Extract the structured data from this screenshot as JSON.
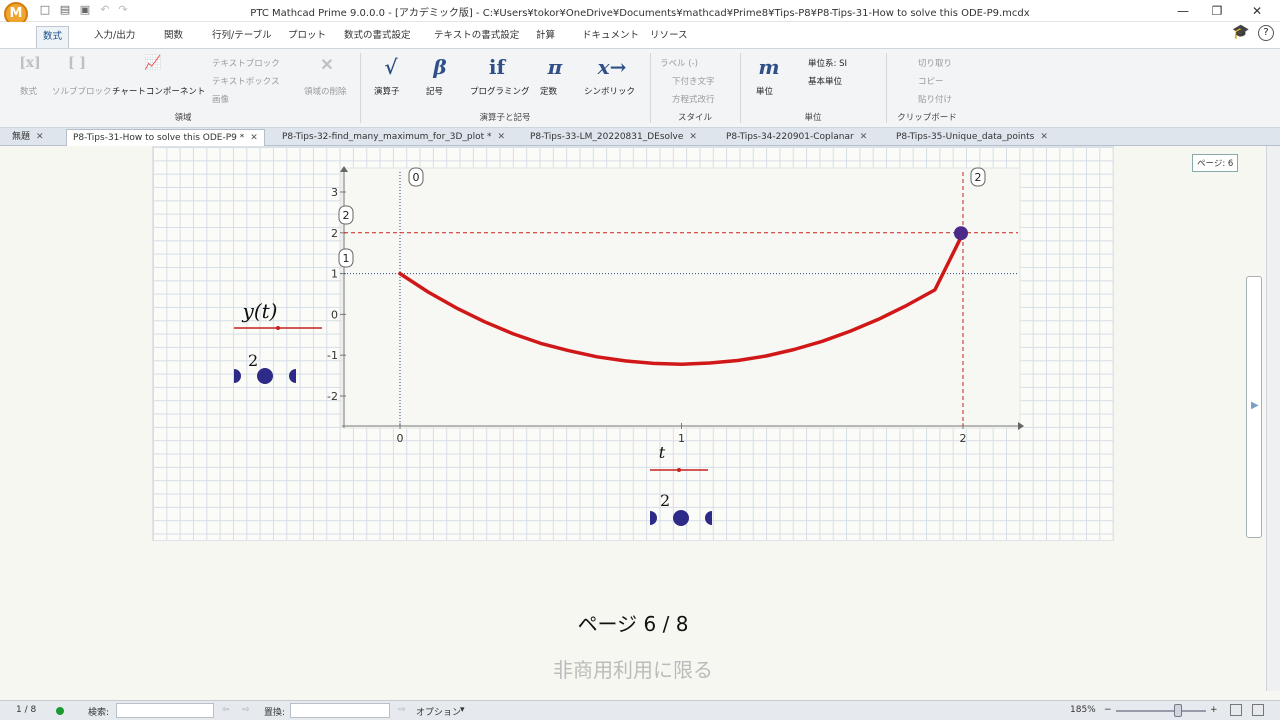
{
  "window": {
    "title": "PTC Mathcad Prime 9.0.0.0 - [アカデミック版] - C:¥Users¥tokor¥OneDrive¥Documents¥mathcad¥Prime8¥Tips-P8¥P8-Tips-31-How to solve this ODE-P9.mcdx",
    "logo_letter": "M"
  },
  "menu": {
    "tabs": [
      "数式",
      "入力/出力",
      "関数",
      "行列/テーブル",
      "プロット",
      "数式の書式設定",
      "テキストの書式設定",
      "計算",
      "ドキュメント",
      "リソース"
    ]
  },
  "ribbon": {
    "region": {
      "math": "数式",
      "solve_block": "ソルブブロック",
      "chart_component": "チャートコンポーネント",
      "text_block": "テキストブロック",
      "text_box": "テキストボックス",
      "image": "画像",
      "delete_region": "領域の削除",
      "label": "領域"
    },
    "operators": {
      "operators": "演算子",
      "symbols": "記号",
      "programming": "プログラミング",
      "constants": "定数",
      "symbolic": "シンボリック",
      "label": "演算子と記号"
    },
    "style": {
      "label_btn": "ラベル (-)",
      "subscript": "下付き文字",
      "equation_wrap": "方程式改行",
      "label": "スタイル"
    },
    "units": {
      "units": "単位",
      "unit_system": "単位系: SI",
      "base_units": "基本単位",
      "label": "単位"
    },
    "clipboard": {
      "cut": "切り取り",
      "copy": "コピー",
      "paste": "貼り付け",
      "label": "クリップボード"
    }
  },
  "doc_tabs": [
    {
      "label": "無題"
    },
    {
      "label": "P8-Tips-31-How to solve this ODE-P9 *"
    },
    {
      "label": "P8-Tips-32-find_many_maximum_for_3D_plot *"
    },
    {
      "label": "P8-Tips-33-LM_20220831_DEsolve"
    },
    {
      "label": "P8-Tips-34-220901-Coplanar"
    },
    {
      "label": "P8-Tips-35-Unique_data_points"
    }
  ],
  "worksheet": {
    "page_indicator": "ページ: 6",
    "page_footer": "ページ 6 / 8",
    "watermark": "非商用利用に限る"
  },
  "chart_data": {
    "type": "line",
    "series": [
      {
        "name": "y(t)",
        "x": [
          0,
          0.1,
          0.2,
          0.3,
          0.4,
          0.5,
          0.6,
          0.7,
          0.8,
          0.9,
          1,
          1.1,
          1.2,
          1.3,
          1.4,
          1.5,
          1.6,
          1.7,
          1.8,
          1.9,
          2
        ],
        "y": [
          1,
          0.55,
          0.16,
          -0.18,
          -0.47,
          -0.71,
          -0.89,
          -1.04,
          -1.14,
          -1.2,
          -1.22,
          -1.19,
          -1.13,
          -1.02,
          -0.86,
          -0.66,
          -0.41,
          -0.12,
          0.22,
          0.6,
          1.99
        ]
      }
    ],
    "xlim": [
      0,
      2
    ],
    "ylim": [
      -2,
      3
    ],
    "x_ticks": [
      "0",
      "1",
      "2"
    ],
    "y_ticks": [
      "-2",
      "-1",
      "0",
      "1",
      "2",
      "3"
    ],
    "xlabel": "t",
    "ylabel": "y(t)",
    "x_axis_count": "2",
    "y_axis_count": "2",
    "markers": {
      "x_left": "0",
      "x_right": "2",
      "y_top": "2",
      "y_bottom": "1"
    },
    "colors": {
      "line": "#d01818",
      "marker_line": "#cc2020",
      "dotted": "#2a4a88",
      "point": "#4b2a88"
    },
    "grid": false
  },
  "status": {
    "page": "1 / 8",
    "search_label": "検索:",
    "replace_label": "置換:",
    "options": "オプション",
    "zoom": "185%"
  }
}
